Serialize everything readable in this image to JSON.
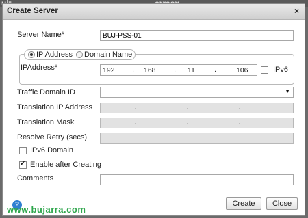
{
  "background": {
    "left_text": "ult",
    "right_text": "crrasx"
  },
  "dialog": {
    "title": "Create Server",
    "close_glyph": "×",
    "server_name": {
      "label": "Server Name*",
      "value": "BUJ-PSS-01"
    },
    "address_type": {
      "options": [
        "IP Address",
        "Domain Name"
      ],
      "selected": "IP Address"
    },
    "ip_address": {
      "label": "IPAddress*",
      "octets": [
        "192",
        "168",
        "11",
        "106"
      ],
      "ipv6_label": "IPv6",
      "ipv6_checked": false
    },
    "traffic_domain": {
      "label": "Traffic Domain ID",
      "value": ""
    },
    "translation_ip": {
      "label": "Translation IP Address"
    },
    "translation_mask": {
      "label": "Translation Mask"
    },
    "resolve_retry": {
      "label": "Resolve Retry (secs)",
      "value": ""
    },
    "ipv6_domain": {
      "label": "IPv6 Domain",
      "checked": false
    },
    "enable_after_creating": {
      "label": "Enable after Creating",
      "checked": true
    },
    "comments": {
      "label": "Comments",
      "value": ""
    },
    "buttons": {
      "create": "Create",
      "close": "Close"
    },
    "help_glyph": "?"
  },
  "watermark": "www.bujarra.com",
  "colors": {
    "help_icon": "#2f7fd1",
    "watermark": "#2ea64c",
    "disabled_field": "#e2e2e2"
  }
}
